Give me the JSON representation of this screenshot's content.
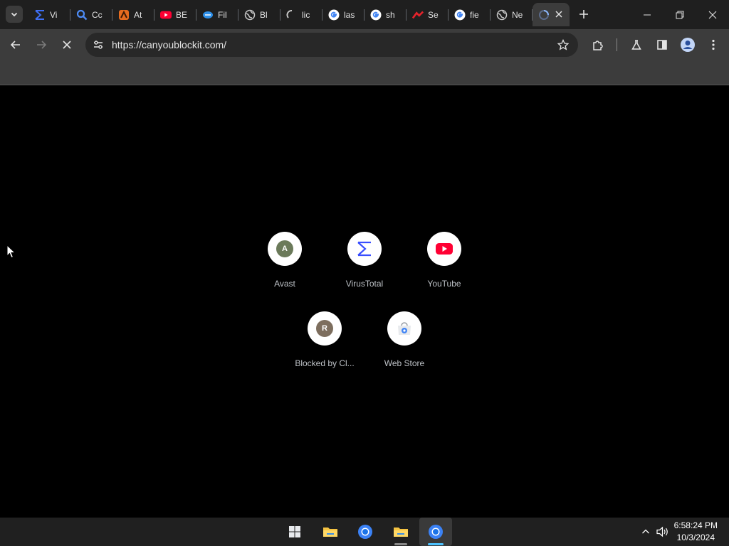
{
  "tabs": [
    {
      "title": "Vi",
      "icon": "virustotal-icon"
    },
    {
      "title": "Cc",
      "icon": "search-icon"
    },
    {
      "title": "At",
      "icon": "avast-icon"
    },
    {
      "title": "BE",
      "icon": "youtube-icon"
    },
    {
      "title": "Fil",
      "icon": "filehippo-icon"
    },
    {
      "title": "Bl",
      "icon": "globe-icon"
    },
    {
      "title": "lic",
      "icon": "loading-icon"
    },
    {
      "title": "las",
      "icon": "google-icon"
    },
    {
      "title": "sh",
      "icon": "google-icon"
    },
    {
      "title": "Se",
      "icon": "speedtest-icon"
    },
    {
      "title": "fie",
      "icon": "google-icon"
    },
    {
      "title": "Ne",
      "icon": "globe-icon"
    },
    {
      "title": "",
      "icon": "loading-spinner-icon",
      "active": true
    }
  ],
  "toolbar": {
    "url": "https://canyoublockit.com/"
  },
  "shortcuts": [
    {
      "label": "Avast",
      "icon": "letter-a-icon",
      "letter": "A",
      "color": "#6b7a5a"
    },
    {
      "label": "VirusTotal",
      "icon": "virustotal-icon"
    },
    {
      "label": "YouTube",
      "icon": "youtube-icon"
    },
    {
      "label": "Blocked by Cl...",
      "icon": "letter-r-icon",
      "letter": "R",
      "color": "#7d6e5e"
    },
    {
      "label": "Web Store",
      "icon": "chrome-web-store-icon"
    }
  ],
  "clock": {
    "time": "6:58:24 PM",
    "date": "10/3/2024"
  },
  "colors": {
    "tabstrip": "#1f1f1f",
    "toolbar": "#3c3c3c",
    "omnibox": "#282828",
    "page": "#000000",
    "taskbar": "#202020",
    "accent": "#4cc2ff"
  }
}
